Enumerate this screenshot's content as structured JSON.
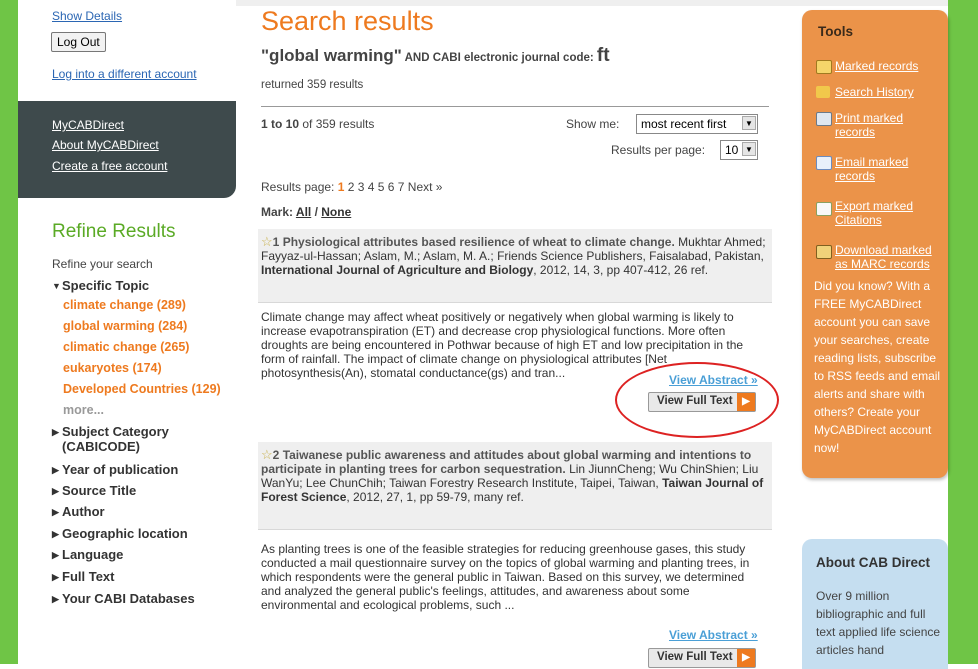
{
  "account": {
    "show_details": "Show Details",
    "log_out": "Log Out",
    "log_into_different": "Log into a different account"
  },
  "dark_panel": {
    "links": [
      "MyCABDirect",
      "About MyCABDirect",
      "Create a free account"
    ]
  },
  "refine": {
    "title": "Refine Results",
    "subtitle": "Refine your search",
    "specific_topic": "Specific Topic",
    "topics": [
      "climate change (289)",
      "global warming (284)",
      "climatic change (265)",
      "eukaryotes (174)",
      "Developed Countries (129)"
    ],
    "more": "more...",
    "facets": [
      "Subject Category (CABICODE)",
      "Year of publication",
      "Source Title",
      "Author",
      "Geographic location",
      "Language",
      "Full Text",
      "Your CABI Databases"
    ]
  },
  "main": {
    "title": "Search results",
    "query_term": "\"global warming\"",
    "query_and": " AND CABI electronic journal code: ",
    "query_code": "ft",
    "returned": "returned 359 results",
    "range_bold": "1 to 10",
    "range_rest": " of 359 results",
    "show_me_label": "Show me:",
    "show_me_value": "most recent first",
    "rpp_label": "Results per page:",
    "rpp_value": "10",
    "pages_label": "Results page: ",
    "current_page": "1",
    "other_pages": " 2 3 4 5 6 7 Next »",
    "mark_label": "Mark: ",
    "mark_all": "All",
    "mark_sep": " / ",
    "mark_none": "None"
  },
  "results": [
    {
      "number": "1",
      "title": "Physiological attributes based resilience of wheat to climate change.",
      "authors": " Mukhtar Ahmed; Fayyaz-ul-Hassan; Aslam, M.; Aslam, M. A.; Friends Science Publishers, Faisalabad, Pakistan, ",
      "journal": "International Journal of Agriculture and Biology",
      "citation": ", 2012, 14, 3, pp 407-412, 26 ref.",
      "abstract": "Climate change may affect wheat positively or negatively when global warming is likely to increase evapotranspiration (ET) and decrease crop physiological functions. More often droughts are being encountered in Pothwar because of high ET and low precipitation in the form of rainfall. The impact of climate change on physiological attributes [Net photosynthesis(An), stomatal conductance(gs) and tran...",
      "view_abstract": "View Abstract »",
      "view_full_text": "View Full Text"
    },
    {
      "number": "2",
      "title": "Taiwanese public awareness and attitudes about global warming and intentions to participate in planting trees for carbon sequestration.",
      "authors": " Lin JiunnCheng; Wu ChinShien; Liu WanYu; Lee ChunChih; Taiwan Forestry Research Institute, Taipei, Taiwan, ",
      "journal": "Taiwan Journal of Forest Science",
      "citation": ", 2012, 27, 1, pp 59-79, many ref.",
      "abstract": "As planting trees is one of the feasible strategies for reducing greenhouse gases, this study conducted a mail questionnaire survey on the topics of global warming and planting trees, in which respondents were the general public in Taiwan. Based on this survey, we determined and analyzed the general public's feelings, attitudes, and awareness about some environmental and ecological problems, such ...",
      "view_abstract": "View Abstract »",
      "view_full_text": "View Full Text"
    }
  ],
  "tools": {
    "title": "Tools",
    "links": [
      "Marked records",
      "Search History",
      "Print marked records",
      "Email marked records",
      "Export marked Citations",
      "Download marked as MARC records"
    ],
    "promo": "Did you know? With a FREE MyCABDirect account you can save your searches, create reading lists, subscribe to RSS feeds and email alerts and share with others? Create your MyCABDirect account now!"
  },
  "about": {
    "title": "About CAB Direct",
    "text": "Over 9 million bibliographic and full text applied life science articles hand"
  },
  "colors": {
    "orange": "#ee7a1f",
    "green": "#6fc546",
    "tools_bg": "#eb9349",
    "dark_panel": "#3e4a4c",
    "about_bg": "#c5def0",
    "annotation_red": "#d22222"
  }
}
